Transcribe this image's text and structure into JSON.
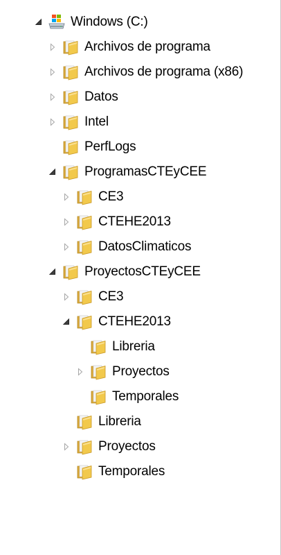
{
  "tree": {
    "items": [
      {
        "id": "windows-c",
        "label": "Windows (C:)",
        "level": 0,
        "expander": "expanded",
        "icon": "drive-icon"
      },
      {
        "id": "archivos-de-programa",
        "label": "Archivos de programa",
        "level": 1,
        "expander": "collapsed",
        "icon": "folder-icon"
      },
      {
        "id": "archivos-de-programa-x86",
        "label": "Archivos de programa (x86)",
        "level": 1,
        "expander": "collapsed",
        "icon": "folder-icon"
      },
      {
        "id": "datos",
        "label": "Datos",
        "level": 1,
        "expander": "collapsed",
        "icon": "folder-icon"
      },
      {
        "id": "intel",
        "label": "Intel",
        "level": 1,
        "expander": "collapsed",
        "icon": "folder-icon"
      },
      {
        "id": "perflogs",
        "label": "PerfLogs",
        "level": 1,
        "expander": "none",
        "icon": "folder-icon"
      },
      {
        "id": "programascteycee",
        "label": "ProgramasCTEyCEE",
        "level": 1,
        "expander": "expanded",
        "icon": "folder-icon"
      },
      {
        "id": "programas-ce3",
        "label": "CE3",
        "level": 2,
        "expander": "collapsed",
        "icon": "folder-icon"
      },
      {
        "id": "programas-ctehe2013",
        "label": "CTEHE2013",
        "level": 2,
        "expander": "collapsed",
        "icon": "folder-icon"
      },
      {
        "id": "datosclimaticos",
        "label": "DatosClimaticos",
        "level": 2,
        "expander": "collapsed",
        "icon": "folder-icon"
      },
      {
        "id": "proyectoscteycee",
        "label": "ProyectosCTEyCEE",
        "level": 1,
        "expander": "expanded",
        "icon": "folder-icon"
      },
      {
        "id": "proyectos-ce3",
        "label": "CE3",
        "level": 2,
        "expander": "collapsed",
        "icon": "folder-icon"
      },
      {
        "id": "proyectos-ctehe2013",
        "label": "CTEHE2013",
        "level": 2,
        "expander": "expanded",
        "icon": "folder-icon"
      },
      {
        "id": "ctehe2013-libreria",
        "label": "Libreria",
        "level": 3,
        "expander": "none",
        "icon": "folder-icon"
      },
      {
        "id": "ctehe2013-proyectos",
        "label": "Proyectos",
        "level": 3,
        "expander": "collapsed",
        "icon": "folder-icon"
      },
      {
        "id": "ctehe2013-temporales",
        "label": "Temporales",
        "level": 3,
        "expander": "none",
        "icon": "folder-icon"
      },
      {
        "id": "libreria",
        "label": "Libreria",
        "level": 2,
        "expander": "none",
        "icon": "folder-icon"
      },
      {
        "id": "proyectos",
        "label": "Proyectos",
        "level": 2,
        "expander": "collapsed",
        "icon": "folder-icon"
      },
      {
        "id": "temporales",
        "label": "Temporales",
        "level": 2,
        "expander": "none",
        "icon": "folder-icon"
      }
    ]
  }
}
